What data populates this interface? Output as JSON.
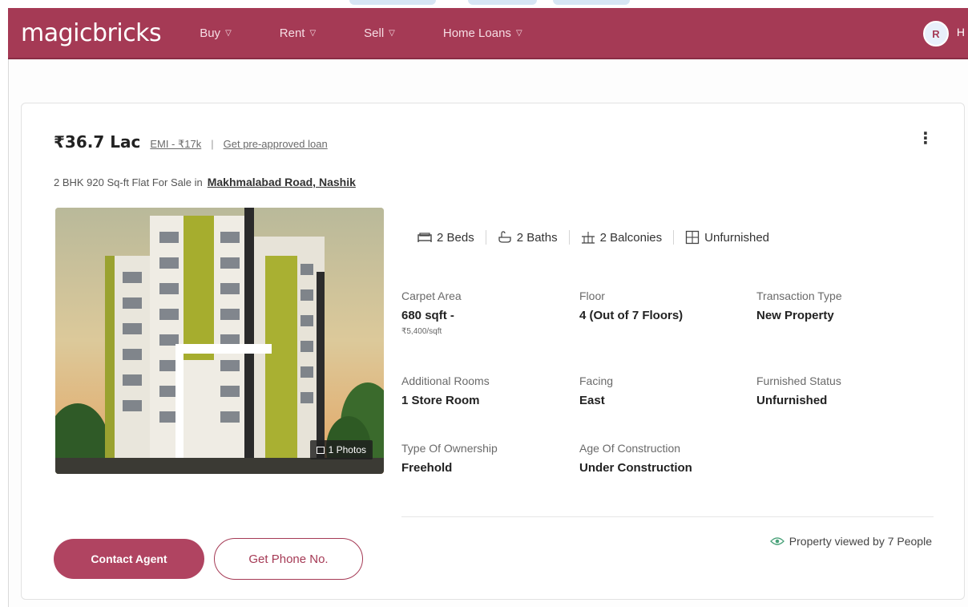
{
  "brand": {
    "name": "magicbricks",
    "color": "#a53a55"
  },
  "nav": {
    "items": [
      {
        "label": "Buy"
      },
      {
        "label": "Rent"
      },
      {
        "label": "Sell"
      },
      {
        "label": "Home Loans"
      }
    ],
    "avatar_initial": "R",
    "avatar_cut_text": "H"
  },
  "listing": {
    "price": "₹36.7 Lac",
    "emi_link": "EMI - ₹17k",
    "separator": "|",
    "loan_link": "Get pre-approved loan",
    "title_prefix": "2 BHK 920 Sq-ft Flat For Sale in",
    "location": "Makhmalabad Road, Nashik",
    "photo_badge": "1 Photos",
    "amenities": [
      {
        "label": "2 Beds",
        "icon": "bed-icon"
      },
      {
        "label": "2 Baths",
        "icon": "bath-icon"
      },
      {
        "label": "2 Balconies",
        "icon": "balcony-icon"
      },
      {
        "label": "Unfurnished",
        "icon": "furnishing-icon"
      }
    ],
    "details": [
      {
        "label": "Carpet Area",
        "value": "680 sqft -",
        "sub": "₹5,400/sqft"
      },
      {
        "label": "Floor",
        "value": "4 (Out of 7 Floors)"
      },
      {
        "label": "Transaction Type",
        "value": "New Property"
      },
      {
        "label": "Additional Rooms",
        "value": "1 Store Room"
      },
      {
        "label": "Facing",
        "value": "East"
      },
      {
        "label": "Furnished Status",
        "value": "Unfurnished"
      },
      {
        "label": "Type Of Ownership",
        "value": "Freehold"
      },
      {
        "label": "Age Of Construction",
        "value": "Under Construction"
      }
    ],
    "viewed_text": "Property viewed by 7 People",
    "contact_button": "Contact Agent",
    "phone_button": "Get Phone No."
  }
}
